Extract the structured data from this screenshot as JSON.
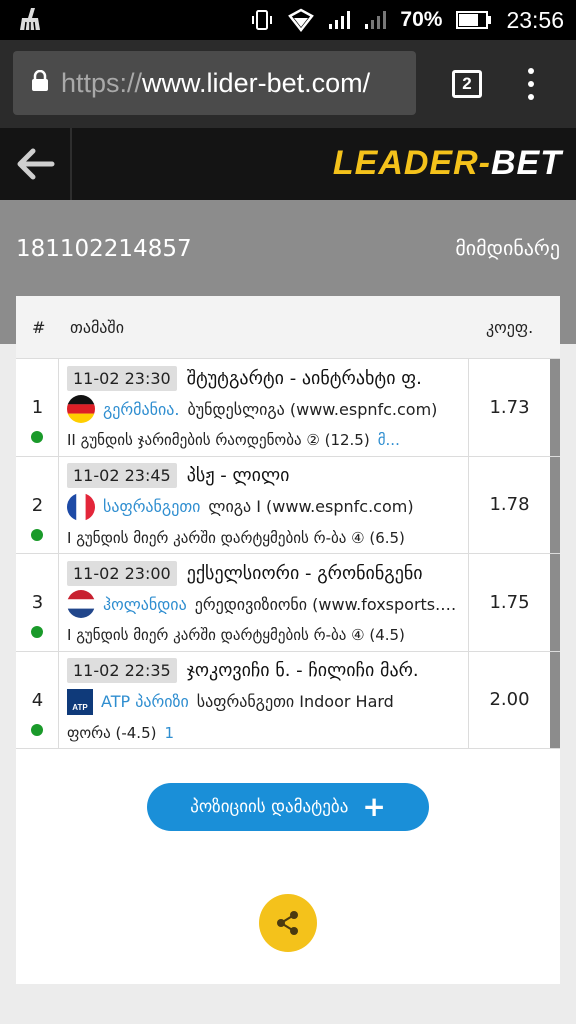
{
  "status_bar": {
    "battery": "70%",
    "time": "23:56",
    "icons": [
      "broom-icon",
      "vibrate-icon",
      "data-arrows-icon",
      "signal-icon",
      "signal-icon",
      "battery-icon"
    ]
  },
  "browser": {
    "url_scheme": "https://",
    "url_host": "www.lider-bet.com/",
    "tab_count": "2"
  },
  "header": {
    "logo_part1": "LEADER",
    "logo_dash": "-",
    "logo_part2": "BET"
  },
  "coupon": {
    "id": "181102214857",
    "status": "მიმდინარე"
  },
  "table": {
    "headers": {
      "num": "#",
      "game": "თამაში",
      "odds": "კოეფ."
    },
    "rows": [
      {
        "num": "1",
        "time": "11-02 23:30",
        "match": "შტუტგარტი - აინტრახტი ფ.",
        "country": "გერმანია.",
        "league": "ბუნდესლიგა (www.espnfc.com)",
        "market": "II გუნდის ჯარიმების რაოდენობა ② (12.5)",
        "pick": "მ...",
        "odds": "1.73"
      },
      {
        "num": "2",
        "time": "11-02 23:45",
        "match": "პსჟ - ლილი",
        "country": "საფრანგეთი",
        "league": "ლიგა I (www.espnfc.com)",
        "market": "I გუნდის მიერ კარში დარტყმების რ-ბა ④ (6.5)",
        "pick": "",
        "odds": "1.78"
      },
      {
        "num": "3",
        "time": "11-02 23:00",
        "match": "ექსელსიორი - გრონინგენი",
        "country": "ჰოლანდია",
        "league": "ერედივიზიონი (www.foxsports.com)",
        "market": "I გუნდის მიერ კარში დარტყმების რ-ბა ④ (4.5)",
        "pick": "",
        "odds": "1.75"
      },
      {
        "num": "4",
        "time": "11-02 22:35",
        "match": "ჯოკოვიჩი ნ. - ჩილიჩი მარ.",
        "country": "ATP პარიზი",
        "league": "საფრანგეთი Indoor Hard",
        "market": "ფორა (-4.5)",
        "pick": "1",
        "odds": "2.00"
      }
    ]
  },
  "actions": {
    "add_position": "პოზიციის დამატება",
    "badge_text": "ATP"
  },
  "colors": {
    "accent_blue": "#1a8fd8",
    "brand_yellow": "#f4c21b",
    "live_green": "#1a9a2a"
  }
}
